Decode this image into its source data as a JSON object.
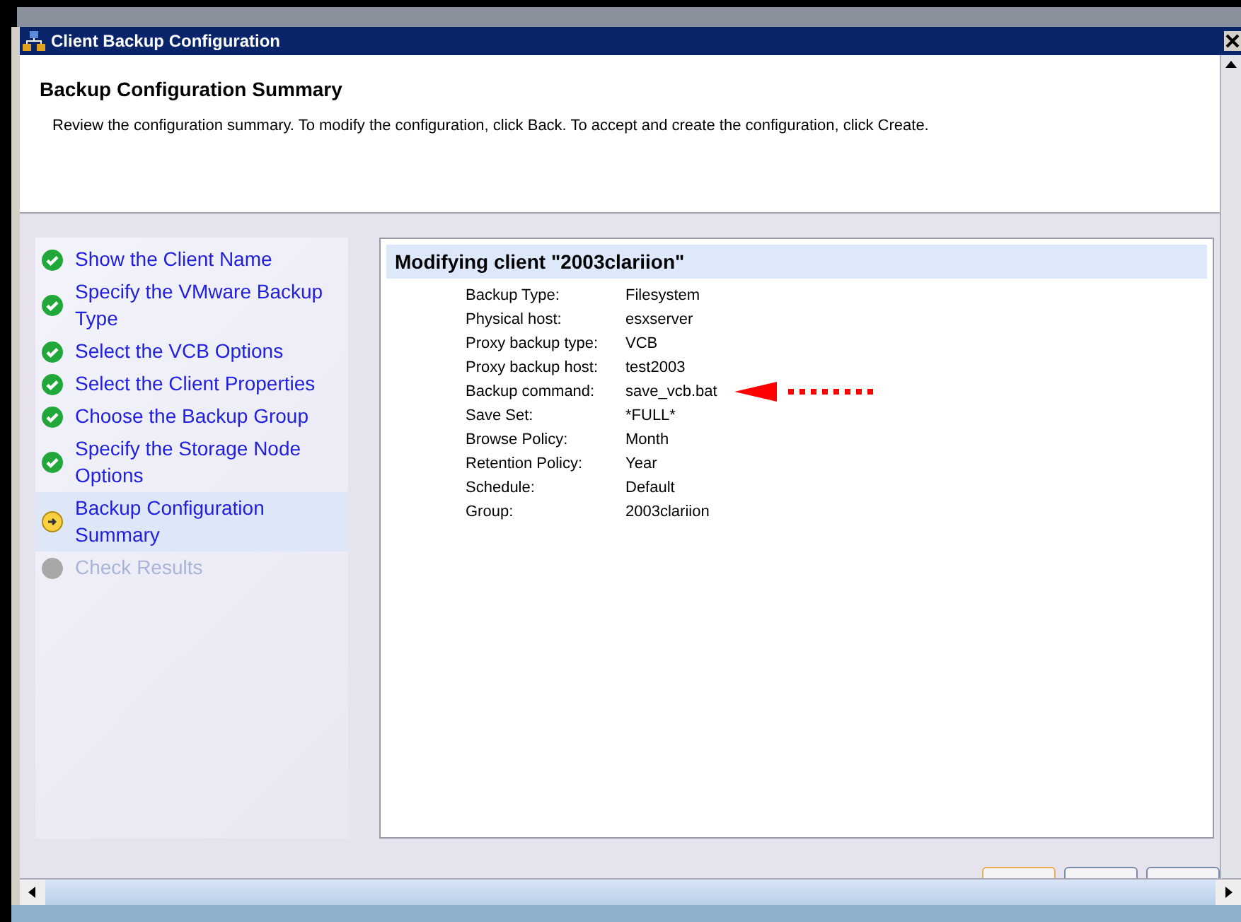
{
  "window": {
    "title": "Client Backup Configuration"
  },
  "header": {
    "title": "Backup Configuration Summary",
    "description": "Review the configuration summary. To modify the configuration, click Back. To accept and create the configuration, click Create."
  },
  "steps": [
    {
      "label": "Show the Client Name",
      "completed": true,
      "selected": false,
      "disabled": false
    },
    {
      "label": "Specify the VMware Backup Type",
      "completed": true,
      "selected": false,
      "disabled": false
    },
    {
      "label": "Select the VCB Options",
      "completed": true,
      "selected": false,
      "disabled": false
    },
    {
      "label": "Select the Client Properties",
      "completed": true,
      "selected": false,
      "disabled": false
    },
    {
      "label": "Choose the Backup Group",
      "completed": true,
      "selected": false,
      "disabled": false
    },
    {
      "label": "Specify the Storage Node Options",
      "completed": true,
      "selected": false,
      "disabled": false
    },
    {
      "label": "Backup Configuration Summary",
      "completed": false,
      "selected": true,
      "disabled": false
    },
    {
      "label": "Check Results",
      "completed": false,
      "selected": false,
      "disabled": true
    }
  ],
  "summary": {
    "title": "Modifying client \"2003clariion\"",
    "rows": [
      {
        "label": "Backup Type:",
        "value": "Filesystem",
        "annotated": false
      },
      {
        "label": "Physical host:",
        "value": "esxserver",
        "annotated": false
      },
      {
        "label": "Proxy backup type:",
        "value": "VCB",
        "annotated": false
      },
      {
        "label": "Proxy backup host:",
        "value": "test2003",
        "annotated": false
      },
      {
        "label": "Backup command:",
        "value": "save_vcb.bat",
        "annotated": true
      },
      {
        "label": "Save Set:",
        "value": "*FULL*",
        "annotated": false
      },
      {
        "label": "Browse Policy:",
        "value": "Month",
        "annotated": false
      },
      {
        "label": "Retention Policy:",
        "value": "Year",
        "annotated": false
      },
      {
        "label": "Schedule:",
        "value": "Default",
        "annotated": false
      },
      {
        "label": "Group:",
        "value": "2003clariion",
        "annotated": false
      }
    ]
  },
  "buttons": [
    {
      "kind": "default"
    },
    {
      "kind": "normal"
    },
    {
      "kind": "normal"
    }
  ]
}
